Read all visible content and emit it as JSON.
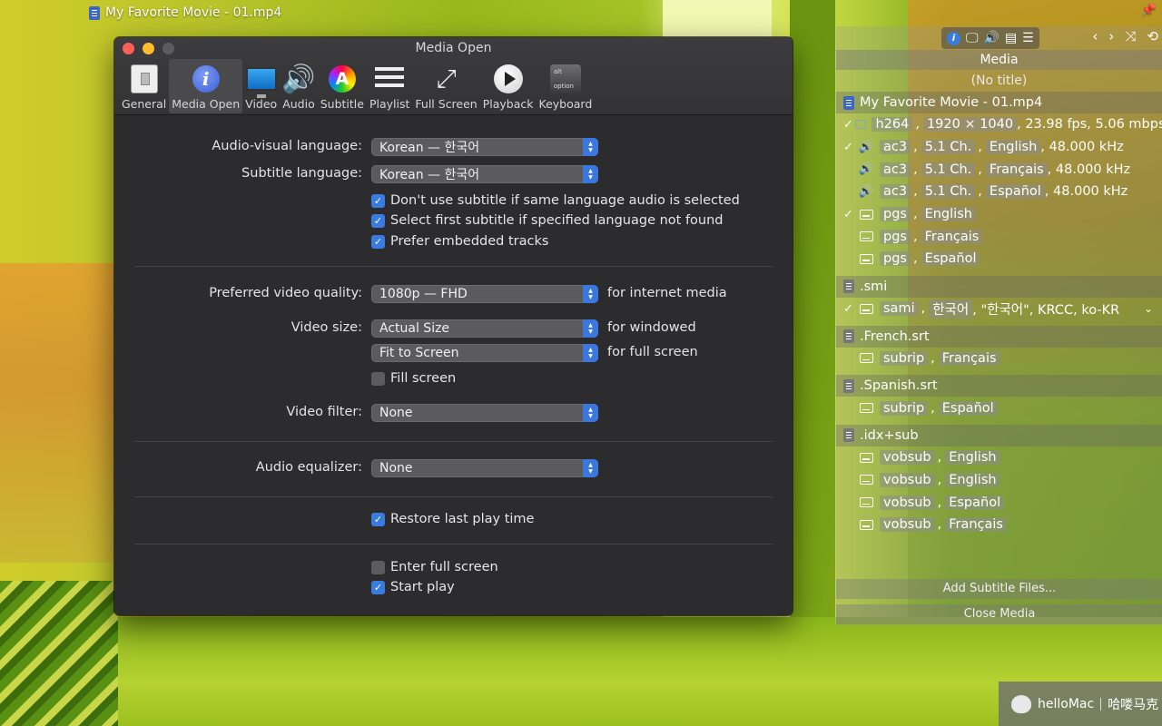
{
  "player": {
    "title": "My Favorite Movie - 01.mp4"
  },
  "prefs": {
    "window_title": "Media Open",
    "toolbar": [
      {
        "label": "General"
      },
      {
        "label": "Media Open"
      },
      {
        "label": "Video"
      },
      {
        "label": "Audio"
      },
      {
        "label": "Subtitle"
      },
      {
        "label": "Playlist"
      },
      {
        "label": "Full Screen"
      },
      {
        "label": "Playback"
      },
      {
        "label": "Keyboard"
      }
    ],
    "keyboard_icon_keys": {
      "top": "alt",
      "bottom": "option"
    },
    "audio_visual_language": {
      "label": "Audio-visual language:",
      "value": "Korean — 한국어"
    },
    "subtitle_language": {
      "label": "Subtitle language:",
      "value": "Korean — 한국어"
    },
    "options1": [
      {
        "label": "Don't use subtitle if same language audio is selected",
        "checked": true
      },
      {
        "label": "Select first subtitle if specified language not found",
        "checked": true
      },
      {
        "label": "Prefer embedded tracks",
        "checked": true
      }
    ],
    "video_quality": {
      "label": "Preferred video quality:",
      "value": "1080p — FHD",
      "suffix": "for internet media"
    },
    "video_size": {
      "label": "Video size:",
      "windowed_value": "Actual Size",
      "windowed_suffix": "for windowed",
      "full_value": "Fit to Screen",
      "full_suffix": "for full screen"
    },
    "fill_screen": {
      "label": "Fill screen",
      "checked": false
    },
    "video_filter": {
      "label": "Video filter:",
      "value": "None"
    },
    "audio_equalizer": {
      "label": "Audio equalizer:",
      "value": "None"
    },
    "restore": {
      "label": "Restore last play time",
      "checked": true
    },
    "enter_full": {
      "label": "Enter full screen",
      "checked": false
    },
    "start_play": {
      "label": "Start play",
      "checked": true
    }
  },
  "inspector": {
    "header": "Media",
    "subheader": "(No title)",
    "file": "My Favorite Movie - 01.mp4",
    "embedded_tracks": [
      {
        "check": "✓",
        "icon": "monitor-icon",
        "codec": "h264",
        "detail": "1920 × 1040",
        "rest": ", 23.98 fps, 5.06 mbps"
      },
      {
        "check": "✓",
        "icon": "speaker-icon",
        "codec": "ac3",
        "detail": "5.1 Ch.",
        "lang": "English",
        "rest": ", 48.000 kHz"
      },
      {
        "check": "",
        "icon": "speaker-icon",
        "codec": "ac3",
        "detail": "5.1 Ch.",
        "lang": "Français",
        "rest": ", 48.000 kHz"
      },
      {
        "check": "",
        "icon": "speaker-icon",
        "codec": "ac3",
        "detail": "5.1 Ch.",
        "lang": "Español",
        "rest": ", 48.000 kHz"
      },
      {
        "check": "✓",
        "icon": "subtitle-icon",
        "codec": "pgs",
        "lang": "English"
      },
      {
        "check": "",
        "icon": "subtitle-icon",
        "codec": "pgs",
        "lang": "Français"
      },
      {
        "check": "",
        "icon": "subtitle-icon",
        "codec": "pgs",
        "lang": "Español"
      }
    ],
    "smi": {
      "name": ".smi",
      "track": {
        "check": "✓",
        "codec": "sami",
        "lang": "한국어",
        "rest": ", \"한국어\", KRCC, ko-KR"
      }
    },
    "french_srt": {
      "name": ".French.srt",
      "track": {
        "codec": "subrip",
        "lang": "Français"
      }
    },
    "spanish_srt": {
      "name": ".Spanish.srt",
      "track": {
        "codec": "subrip",
        "lang": "Español"
      }
    },
    "idx_sub": {
      "name": ".idx+sub",
      "tracks": [
        {
          "codec": "vobsub",
          "lang": "English"
        },
        {
          "codec": "vobsub",
          "lang": "English"
        },
        {
          "codec": "vobsub",
          "lang": "Español"
        },
        {
          "codec": "vobsub",
          "lang": "Français"
        }
      ]
    },
    "add_button": "Add Subtitle Files...",
    "close_button": "Close Media"
  },
  "watermark": {
    "brand": "helloMac",
    "cn": "哈喽马克"
  }
}
